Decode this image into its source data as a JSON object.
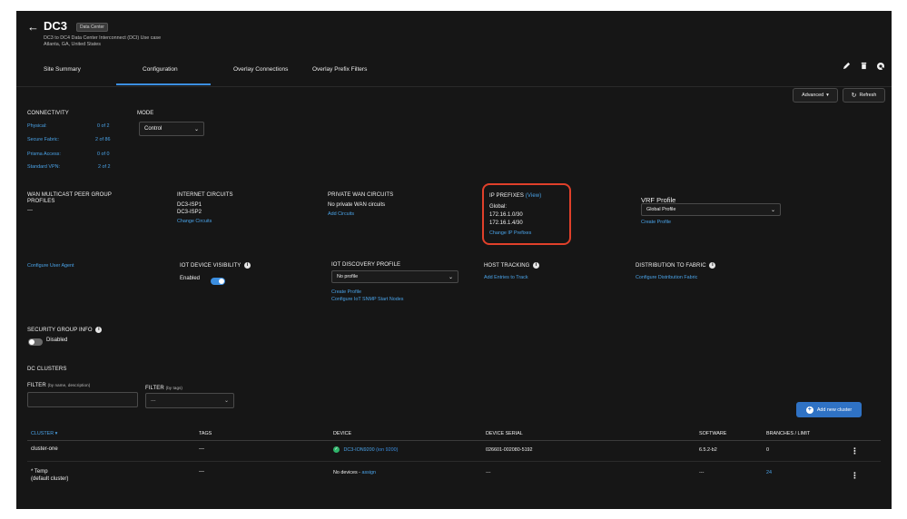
{
  "header": {
    "back_glyph": "←",
    "title": "DC3",
    "badge": "Data Center",
    "description": "DC3 to DC4 Data Center Interconnect (DCI) Use case",
    "location": "Atlanta, GA, United States"
  },
  "tabs": [
    {
      "label": "Site Summary"
    },
    {
      "label": "Configuration",
      "active": true
    },
    {
      "label": "Overlay Connections"
    },
    {
      "label": "Overlay Prefix Filters"
    }
  ],
  "toolbar": {
    "advanced_label": "Advanced",
    "refresh_label": "Refresh",
    "icons": [
      "edit-icon",
      "delete-icon",
      "settings-icon"
    ]
  },
  "connectivity": {
    "heading": "CONNECTIVITY",
    "rows": [
      {
        "label": "Physical:",
        "value": "0 of 2"
      },
      {
        "label": "Secure Fabric:",
        "value": "2 of 86"
      },
      {
        "label": "Prisma Access:",
        "value": "0 of 0"
      },
      {
        "label": "Standard VPN:",
        "value": "2 of 2"
      }
    ]
  },
  "mode": {
    "heading": "MODE",
    "selected": "Control"
  },
  "wan_multicast": {
    "heading_line1": "WAN MULTICAST PEER GROUP",
    "heading_line2": "PROFILES",
    "value": "---"
  },
  "internet_circuits": {
    "heading": "INTERNET CIRCUITS",
    "items": [
      "DC3-ISP1",
      "DC3-ISP2"
    ],
    "link": "Change Circuits"
  },
  "private_wan": {
    "heading": "PRIVATE WAN CIRCUITS",
    "value": "No private WAN circuits",
    "link": "Add Circuits"
  },
  "ip_prefixes": {
    "heading": "IP PREFIXES",
    "view_link": "(View)",
    "global_label": "Global:",
    "items": [
      "172.16.1.0/30",
      "172.16.1.4/30"
    ],
    "link": "Change IP Prefixes",
    "highlight_color": "#e0402a"
  },
  "vrf_profile": {
    "heading": "VRF Profile",
    "selected": "Global Profile",
    "link": "Create Profile"
  },
  "user_agent": {
    "link": "Configure User Agent"
  },
  "iot_visibility": {
    "heading": "IOT DEVICE VISIBILITY",
    "label": "Enabled",
    "enabled": true
  },
  "iot_discovery": {
    "heading": "IOT DISCOVERY PROFILE",
    "selected": "No profile",
    "link1": "Create Profile",
    "link2": "Configure IoT SNMP Start Nodes"
  },
  "host_tracking": {
    "heading": "HOST TRACKING",
    "link": "Add Entries to Track"
  },
  "distribution": {
    "heading": "DISTRIBUTION TO FABRIC",
    "link": "Configure Distribution Fabric"
  },
  "security_group": {
    "heading": "SECURITY GROUP INFO",
    "label": "Disabled",
    "enabled": false
  },
  "dc_clusters": {
    "heading": "DC CLUSTERS",
    "filter1_label": "FILTER",
    "filter1_hint": "(by name, description)",
    "filter2_label": "FILTER",
    "filter2_hint": "(by tags)",
    "filter2_value": "---",
    "add_button": "Add new cluster"
  },
  "table": {
    "columns": [
      "CLUSTER",
      "TAGS",
      "DEVICE",
      "DEVICE SERIAL",
      "SOFTWARE",
      "BRANCHES / LIMIT"
    ],
    "rows": [
      {
        "cluster": "cluster-one",
        "cluster_sub": "",
        "tags": "---",
        "device_name": "DC3-ION9200",
        "device_model": "(ion 9200)",
        "device_prefix": "",
        "serial": "026601-002080-5192",
        "software": "6.5.2-b2",
        "branches": "0"
      },
      {
        "cluster": "* Temp",
        "cluster_sub": "(default cluster)",
        "tags": "---",
        "device_name": "",
        "device_model": "",
        "device_prefix": "No devices - ",
        "device_link": "assign",
        "serial": "---",
        "software": "---",
        "branches": "24"
      }
    ]
  }
}
